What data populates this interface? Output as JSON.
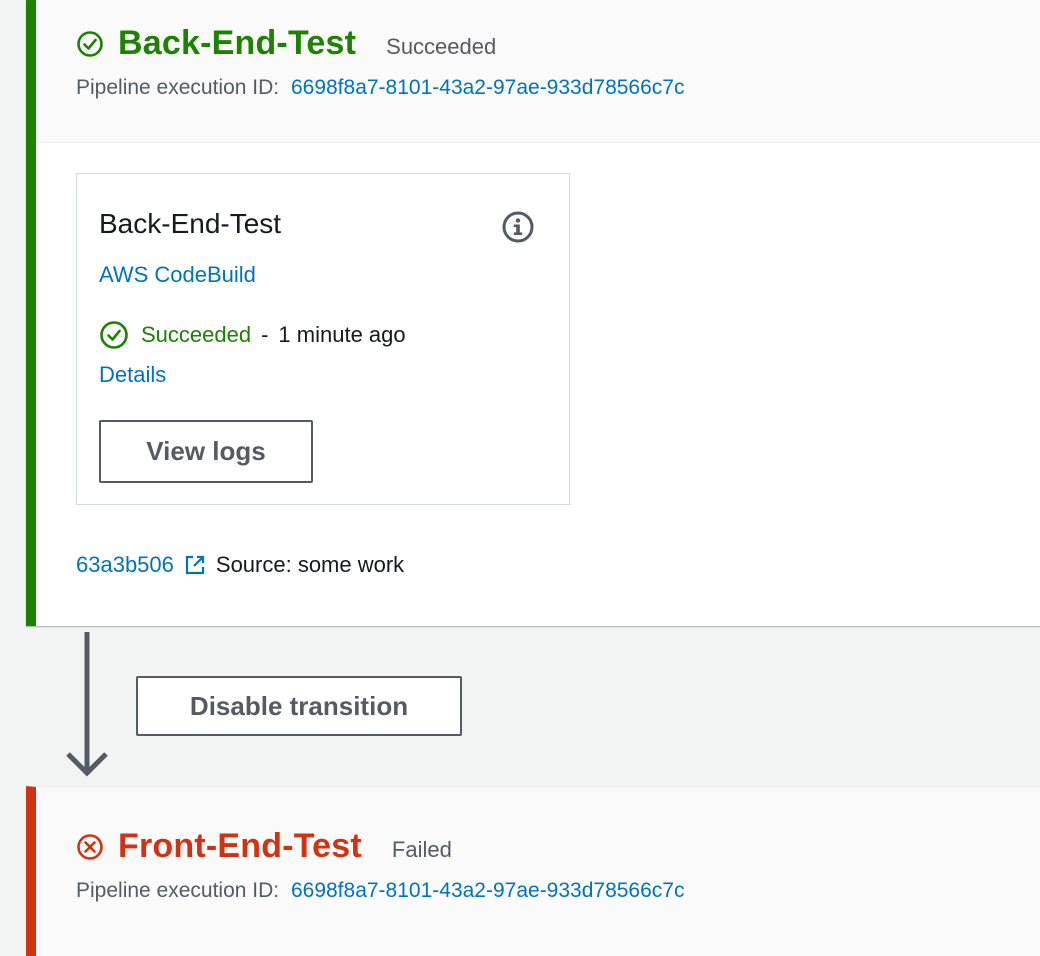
{
  "stages": [
    {
      "name": "Back-End-Test",
      "status": "Succeeded",
      "exec_label": "Pipeline execution ID:",
      "exec_id": "6698f8a7-8101-43a2-97ae-933d78566c7c",
      "status_icon": "check-circle-icon",
      "action": {
        "name": "Back-End-Test",
        "provider": "AWS CodeBuild",
        "status": "Succeeded",
        "separator": "-",
        "time": "1 minute ago",
        "details": "Details",
        "view_logs": "View logs"
      },
      "revision": {
        "id": "63a3b506",
        "text": "Source: some work"
      }
    },
    {
      "name": "Front-End-Test",
      "status": "Failed",
      "exec_label": "Pipeline execution ID:",
      "exec_id": "6698f8a7-8101-43a2-97ae-933d78566c7c",
      "status_icon": "x-circle-icon"
    }
  ],
  "transition": {
    "button_label": "Disable transition"
  },
  "colors": {
    "success": "#1d8102",
    "failure": "#d13212",
    "link": "#0073bb"
  }
}
